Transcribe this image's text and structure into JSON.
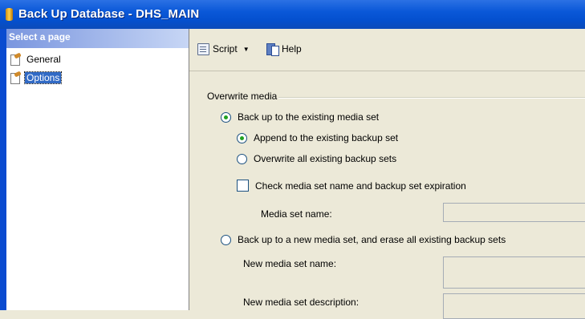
{
  "window": {
    "title": "Back Up Database - DHS_MAIN"
  },
  "left_pane": {
    "header": "Select a page",
    "items": [
      {
        "label": "General",
        "selected": false
      },
      {
        "label": "Options",
        "selected": true
      }
    ]
  },
  "toolbar": {
    "script_label": "Script",
    "help_label": "Help"
  },
  "overwrite_media": {
    "legend": "Overwrite media",
    "existing_media_set": {
      "label": "Back up to the existing media set",
      "checked": true
    },
    "append": {
      "label": "Append to the existing backup set",
      "checked": true
    },
    "overwrite_all": {
      "label": "Overwrite all existing backup sets",
      "checked": false
    },
    "check_media": {
      "label": "Check media set name and backup set expiration",
      "checked": false
    },
    "media_set_name": {
      "label": "Media set name:",
      "value": ""
    },
    "new_media_set": {
      "label": "Back up to a new media set, and erase all existing backup sets",
      "checked": false
    },
    "new_media_set_name": {
      "label": "New media set name:",
      "value": ""
    },
    "new_media_set_description": {
      "label": "New media set description:",
      "value": ""
    }
  },
  "colors": {
    "title_bar": "#0a58d8",
    "selection": "#316ac5",
    "radio_dot": "#21a121"
  }
}
